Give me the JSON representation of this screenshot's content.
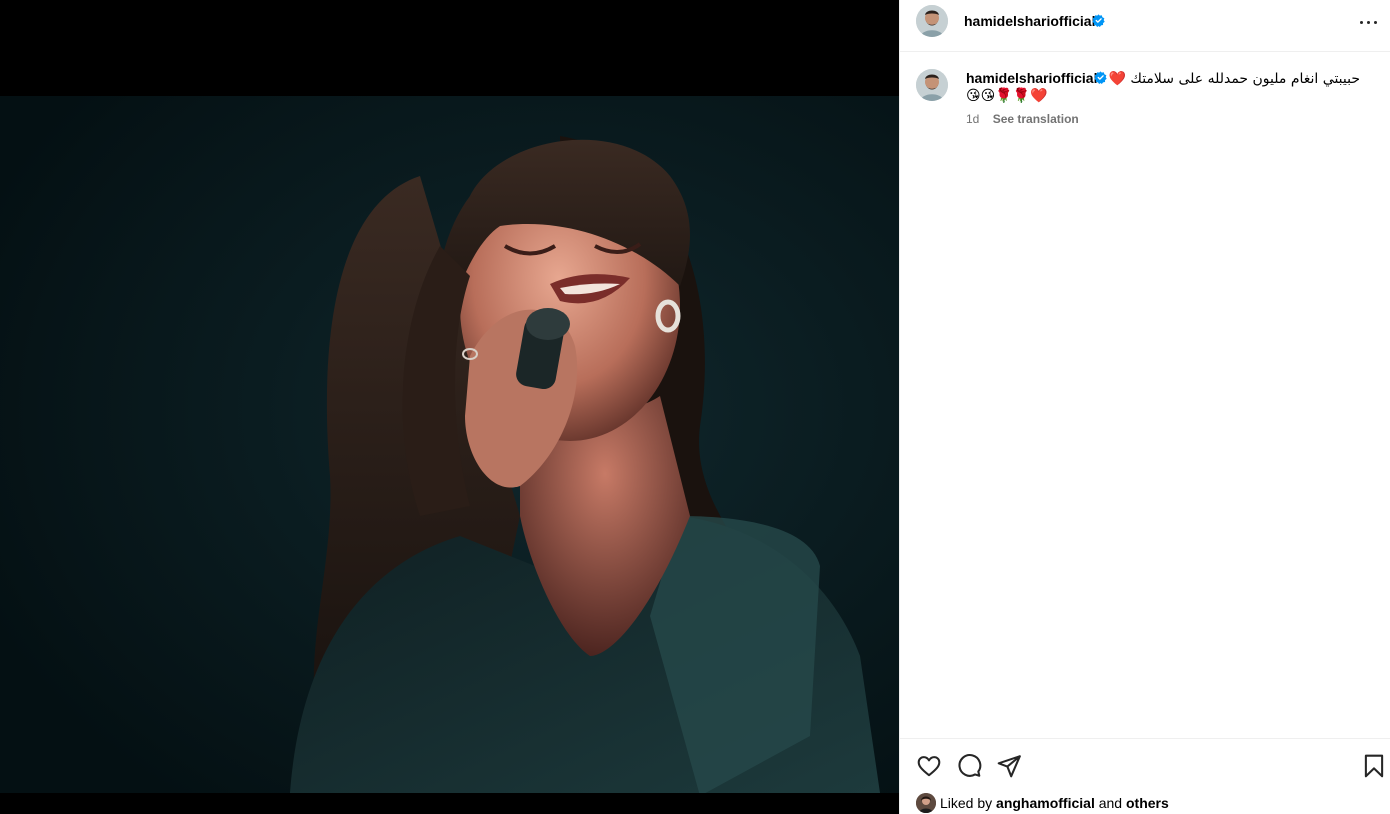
{
  "post": {
    "username": "hamidelshariofficial",
    "verified": true,
    "more_icon": "more-horizontal-icon"
  },
  "caption": {
    "username": "hamidelshariofficial",
    "text_line1": "حبيبتي انغام مليون حمدلله على سلامتك ❤️",
    "text_line2": "😘😘🌹🌹❤️",
    "time": "1d",
    "see_translation": "See translation"
  },
  "actions": {
    "like_icon": "heart-icon",
    "comment_icon": "comment-icon",
    "share_icon": "send-icon",
    "save_icon": "bookmark-icon"
  },
  "likes": {
    "prefix": "Liked by",
    "liker": "anghamofficial",
    "joiner": "and",
    "others": "others"
  },
  "colors": {
    "verified_blue": "#0095f6",
    "meta_gray": "#737373",
    "photo_background": "#071519"
  }
}
